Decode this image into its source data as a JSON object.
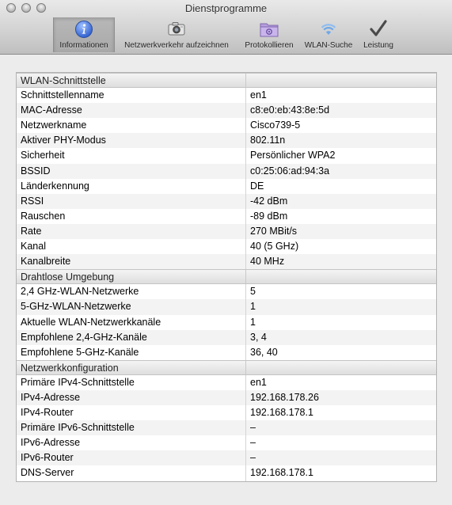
{
  "window": {
    "title": "Dienstprogramme"
  },
  "toolbar": {
    "items": [
      {
        "label": "Informationen",
        "icon": "info-icon"
      },
      {
        "label": "Netzwerkverkehr aufzeichnen",
        "icon": "camera-icon"
      },
      {
        "label": "Protokollieren",
        "icon": "log-folder-icon"
      },
      {
        "label": "WLAN-Suche",
        "icon": "wifi-icon"
      },
      {
        "label": "Leistung",
        "icon": "checkmark-icon"
      }
    ]
  },
  "sections": [
    {
      "title": "WLAN-Schnittstelle",
      "rows": [
        {
          "key": "Schnittstellenname",
          "value": "en1"
        },
        {
          "key": "MAC-Adresse",
          "value": "c8:e0:eb:43:8e:5d"
        },
        {
          "key": "Netzwerkname",
          "value": "Cisco739-5"
        },
        {
          "key": "Aktiver PHY-Modus",
          "value": "802.11n"
        },
        {
          "key": "Sicherheit",
          "value": "Persönlicher WPA2"
        },
        {
          "key": "BSSID",
          "value": "c0:25:06:ad:94:3a"
        },
        {
          "key": "Länderkennung",
          "value": "DE"
        },
        {
          "key": "RSSI",
          "value": "-42 dBm"
        },
        {
          "key": "Rauschen",
          "value": "-89 dBm"
        },
        {
          "key": "Rate",
          "value": "270 MBit/s"
        },
        {
          "key": "Kanal",
          "value": "40 (5 GHz)"
        },
        {
          "key": "Kanalbreite",
          "value": "40 MHz"
        }
      ]
    },
    {
      "title": "Drahtlose Umgebung",
      "rows": [
        {
          "key": "2,4 GHz-WLAN-Netzwerke",
          "value": "5"
        },
        {
          "key": "5-GHz-WLAN-Netzwerke",
          "value": "1"
        },
        {
          "key": "Aktuelle WLAN-Netzwerkkanäle",
          "value": "1"
        },
        {
          "key": "Empfohlene 2,4-GHz-Kanäle",
          "value": "3, 4"
        },
        {
          "key": "Empfohlene 5-GHz-Kanäle",
          "value": "36, 40"
        }
      ]
    },
    {
      "title": "Netzwerkkonfiguration",
      "rows": [
        {
          "key": "Primäre IPv4-Schnittstelle",
          "value": "en1"
        },
        {
          "key": "IPv4-Adresse",
          "value": "192.168.178.26"
        },
        {
          "key": "IPv4-Router",
          "value": "192.168.178.1"
        },
        {
          "key": "Primäre IPv6-Schnittstelle",
          "value": "–"
        },
        {
          "key": "IPv6-Adresse",
          "value": "–"
        },
        {
          "key": "IPv6-Router",
          "value": "–"
        },
        {
          "key": "DNS-Server",
          "value": "192.168.178.1"
        }
      ]
    }
  ],
  "colors": {
    "info_blue": "#3f6fd8",
    "selected_tab": "#adadad",
    "row_alt": "#f3f3f3"
  }
}
